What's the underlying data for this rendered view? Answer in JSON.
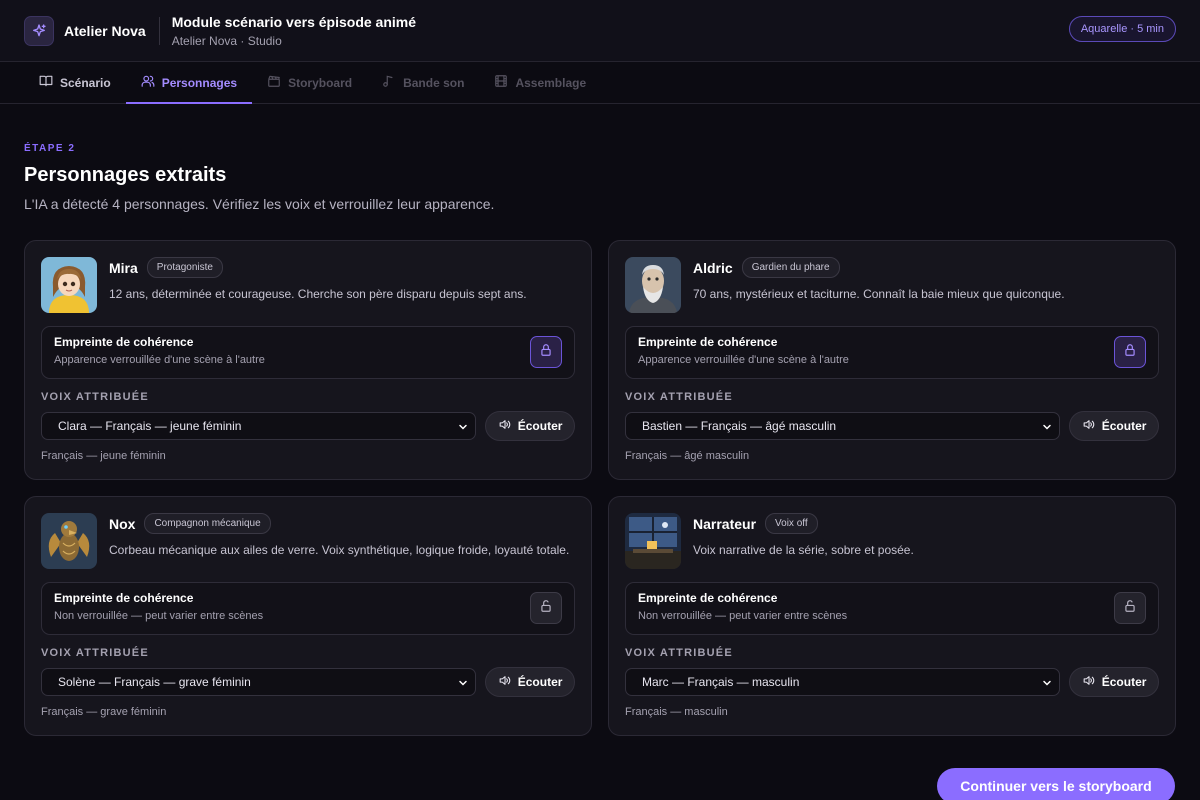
{
  "app": {
    "brand": "Atelier Nova",
    "title": "Module scénario vers épisode animé",
    "subtitle": "Atelier Nova · Studio",
    "badge": "Aquarelle · 5 min"
  },
  "tabs": [
    {
      "label": "Scénario",
      "icon": "book-icon",
      "state": "normal"
    },
    {
      "label": "Personnages",
      "icon": "users-icon",
      "state": "active"
    },
    {
      "label": "Storyboard",
      "icon": "clapper-icon",
      "state": "disabled"
    },
    {
      "label": "Bande son",
      "icon": "music-note-icon",
      "state": "disabled"
    },
    {
      "label": "Assemblage",
      "icon": "film-icon",
      "state": "disabled"
    }
  ],
  "main": {
    "step": "ÉTAPE 2",
    "title": "Personnages extraits",
    "description": "L'IA a détecté 4 personnages. Vérifiez les voix et verrouillez leur apparence."
  },
  "labels": {
    "consistency_title": "Empreinte de cohérence",
    "voice_label": "VOIX ATTRIBUÉE",
    "listen": "Écouter"
  },
  "characters": [
    {
      "name": "Mira",
      "role": "Protagoniste",
      "description": "12 ans, déterminée et courageuse. Cherche son père disparu depuis sept ans.",
      "locked": true,
      "lock_status": "Apparence verrouillée d'une scène à l'autre",
      "voice": "Clara — Français — jeune féminin",
      "voice_caption": "Français — jeune féminin"
    },
    {
      "name": "Aldric",
      "role": "Gardien du phare",
      "description": "70 ans, mystérieux et taciturne. Connaît la baie mieux que quiconque.",
      "locked": true,
      "lock_status": "Apparence verrouillée d'une scène à l'autre",
      "voice": "Bastien — Français — âgé masculin",
      "voice_caption": "Français — âgé masculin"
    },
    {
      "name": "Nox",
      "role": "Compagnon mécanique",
      "description": "Corbeau mécanique aux ailes de verre. Voix synthétique, logique froide, loyauté totale.",
      "locked": false,
      "lock_status": "Non verrouillée — peut varier entre scènes",
      "voice": "Solène — Français — grave féminin",
      "voice_caption": "Français — grave féminin"
    },
    {
      "name": "Narrateur",
      "role": "Voix off",
      "description": "Voix narrative de la série, sobre et posée.",
      "locked": false,
      "lock_status": "Non verrouillée — peut varier entre scènes",
      "voice": "Marc — Français — masculin",
      "voice_caption": "Français — masculin"
    }
  ],
  "cta": {
    "label": "Continuer vers le storyboard"
  },
  "colors": {
    "accent": "#8b6dff",
    "background": "#0c0b12",
    "card": "#16151d"
  }
}
